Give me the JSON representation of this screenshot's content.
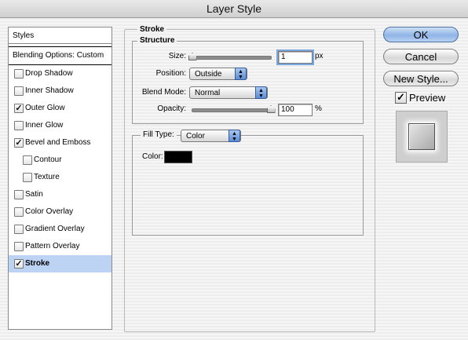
{
  "window": {
    "title": "Layer Style"
  },
  "sidebar": {
    "header": "Styles",
    "blending": "Blending Options: Custom",
    "items": [
      {
        "label": "Drop Shadow",
        "checked": false,
        "indent": false,
        "selected": false
      },
      {
        "label": "Inner Shadow",
        "checked": false,
        "indent": false,
        "selected": false
      },
      {
        "label": "Outer Glow",
        "checked": true,
        "indent": false,
        "selected": false
      },
      {
        "label": "Inner Glow",
        "checked": false,
        "indent": false,
        "selected": false
      },
      {
        "label": "Bevel and Emboss",
        "checked": true,
        "indent": false,
        "selected": false
      },
      {
        "label": "Contour",
        "checked": false,
        "indent": true,
        "selected": false
      },
      {
        "label": "Texture",
        "checked": false,
        "indent": true,
        "selected": false
      },
      {
        "label": "Satin",
        "checked": false,
        "indent": false,
        "selected": false
      },
      {
        "label": "Color Overlay",
        "checked": false,
        "indent": false,
        "selected": false
      },
      {
        "label": "Gradient Overlay",
        "checked": false,
        "indent": false,
        "selected": false
      },
      {
        "label": "Pattern Overlay",
        "checked": false,
        "indent": false,
        "selected": false
      },
      {
        "label": "Stroke",
        "checked": true,
        "indent": false,
        "selected": true
      }
    ]
  },
  "stroke": {
    "section_title": "Stroke",
    "structure_title": "Structure",
    "size_label": "Size:",
    "size_value": "1",
    "size_unit": "px",
    "size_slider_fraction": 0.0,
    "position_label": "Position:",
    "position_value": "Outside",
    "blend_mode_label": "Blend Mode:",
    "blend_mode_value": "Normal",
    "opacity_label": "Opacity:",
    "opacity_value": "100",
    "opacity_unit": "%",
    "opacity_slider_fraction": 1.0,
    "fill_type_label": "Fill Type:",
    "fill_type_value": "Color",
    "color_label": "Color:",
    "color_value": "#000000"
  },
  "buttons": {
    "ok": "OK",
    "cancel": "Cancel",
    "new_style": "New Style..."
  },
  "preview": {
    "label": "Preview",
    "checked": true
  },
  "colors": {
    "selection": "#bcd3f3",
    "default_button": "#8fb4e6"
  }
}
